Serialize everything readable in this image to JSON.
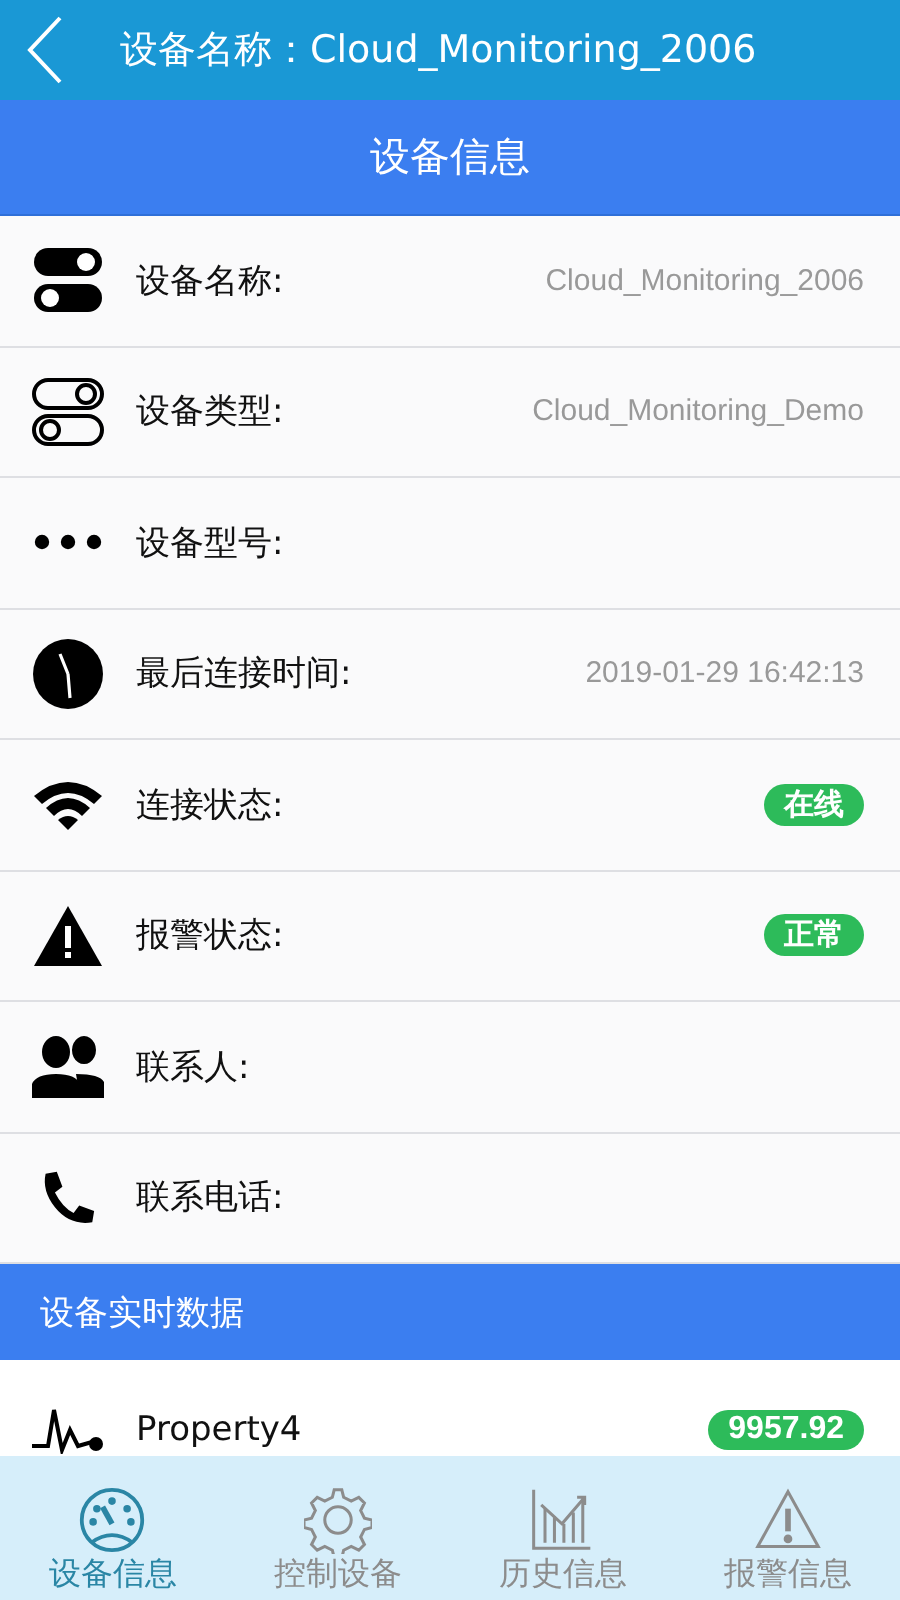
{
  "header": {
    "title": "设备名称：Cloud_Monitoring_2006"
  },
  "section_title": "设备信息",
  "rows": [
    {
      "label": "设备名称:",
      "kind": "text",
      "value": "Cloud_Monitoring_2006"
    },
    {
      "label": "设备类型:",
      "kind": "text",
      "value": "Cloud_Monitoring_Demo"
    },
    {
      "label": "设备型号:",
      "kind": "empty"
    },
    {
      "label": "最后连接时间:",
      "kind": "text",
      "value": "2019-01-29 16:42:13"
    },
    {
      "label": "连接状态:",
      "kind": "badge",
      "value": "在线"
    },
    {
      "label": "报警状态:",
      "kind": "badge",
      "value": "正常"
    },
    {
      "label": "联系人:",
      "kind": "empty"
    },
    {
      "label": "联系电话:",
      "kind": "empty"
    }
  ],
  "realtime": {
    "title": "设备实时数据",
    "items": [
      {
        "name": "Property4",
        "value": "9957.92"
      }
    ]
  },
  "tabs": [
    {
      "label": "设备信息",
      "selected": true
    },
    {
      "label": "控制设备",
      "selected": false
    },
    {
      "label": "历史信息",
      "selected": false
    },
    {
      "label": "报警信息",
      "selected": false
    }
  ]
}
